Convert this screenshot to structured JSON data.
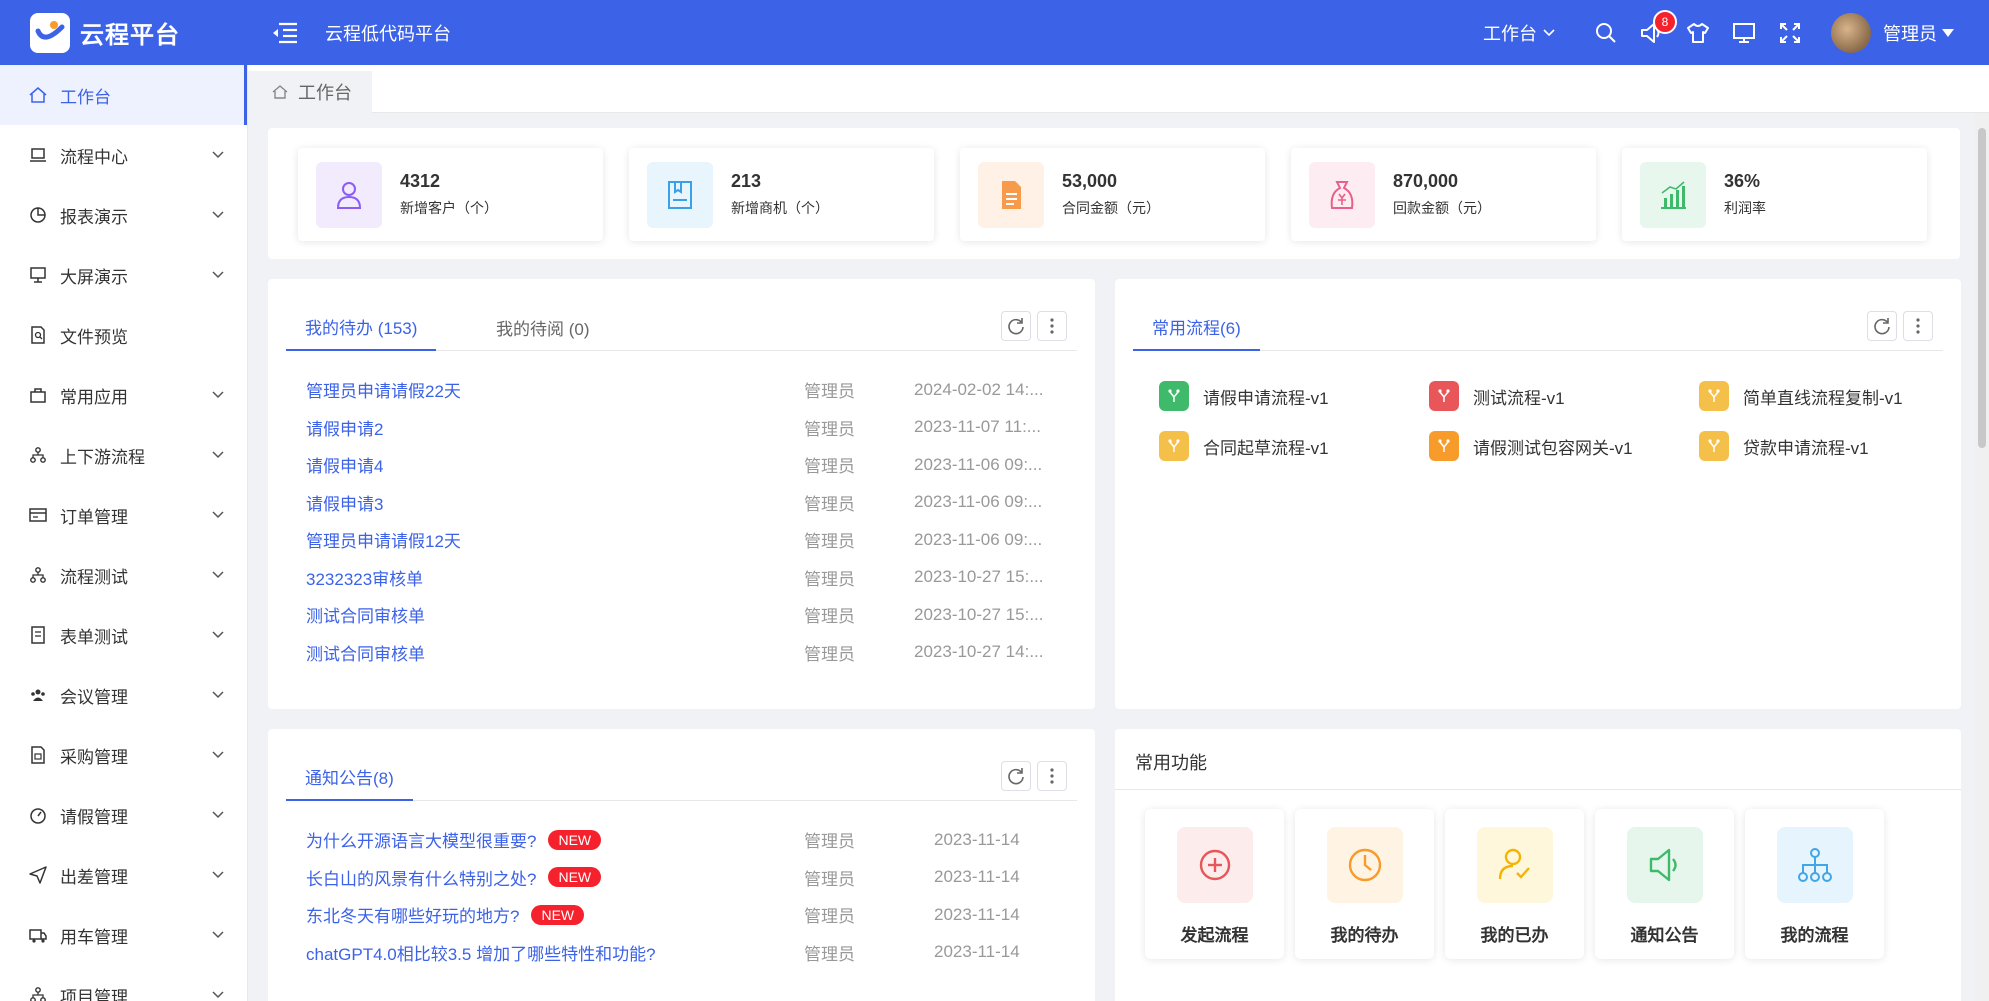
{
  "app": {
    "name": "云程平台",
    "title": "云程低代码平台"
  },
  "header": {
    "workspace_label": "工作台",
    "notification_count": "8",
    "user_name": "管理员"
  },
  "sidebar": {
    "items": [
      {
        "label": "工作台",
        "icon": "home-icon"
      },
      {
        "label": "流程中心",
        "icon": "laptop-icon"
      },
      {
        "label": "报表演示",
        "icon": "pie-chart-icon"
      },
      {
        "label": "大屏演示",
        "icon": "monitor-icon"
      },
      {
        "label": "文件预览",
        "icon": "file-search-icon"
      },
      {
        "label": "常用应用",
        "icon": "bag-icon"
      },
      {
        "label": "上下游流程",
        "icon": "cluster-icon"
      },
      {
        "label": "订单管理",
        "icon": "card-icon"
      },
      {
        "label": "流程测试",
        "icon": "cluster-icon"
      },
      {
        "label": "表单测试",
        "icon": "form-icon"
      },
      {
        "label": "会议管理",
        "icon": "team-icon"
      },
      {
        "label": "采购管理",
        "icon": "file-icon"
      },
      {
        "label": "请假管理",
        "icon": "dashboard-icon"
      },
      {
        "label": "出差管理",
        "icon": "send-icon"
      },
      {
        "label": "用车管理",
        "icon": "car-icon"
      },
      {
        "label": "项目管理",
        "icon": "cluster-icon"
      }
    ]
  },
  "breadcrumb_tab": "工作台",
  "stats": [
    {
      "value": "4312",
      "label": "新增客户（个）",
      "color": "#8b5cf6",
      "bg": "#f1ebfd",
      "icon": "user-icon"
    },
    {
      "value": "213",
      "label": "新增商机（个）",
      "color": "#3aa0e8",
      "bg": "#e9f5fd",
      "icon": "book-icon"
    },
    {
      "value": "53,000",
      "label": "合同金额（元）",
      "color": "#f79b4b",
      "bg": "#fff1e6",
      "icon": "contract-icon"
    },
    {
      "value": "870,000",
      "label": "回款金额（元）",
      "color": "#e8608a",
      "bg": "#fdedf2",
      "icon": "money-bag-icon"
    },
    {
      "value": "36%",
      "label": "利润率",
      "color": "#3fba6b",
      "bg": "#e8f7ee",
      "icon": "bar-chart-icon"
    }
  ],
  "todo": {
    "tabs": [
      "我的待办 (153)",
      "我的待阅 (0)"
    ],
    "rows": [
      {
        "title": "管理员申请请假22天",
        "user": "管理员",
        "time": "2024-02-02 14:..."
      },
      {
        "title": "请假申请2",
        "user": "管理员",
        "time": "2023-11-07 11:..."
      },
      {
        "title": "请假申请4",
        "user": "管理员",
        "time": "2023-11-06 09:..."
      },
      {
        "title": "请假申请3",
        "user": "管理员",
        "time": "2023-11-06 09:..."
      },
      {
        "title": "管理员申请请假12天",
        "user": "管理员",
        "time": "2023-11-06 09:..."
      },
      {
        "title": "3232323审核单",
        "user": "管理员",
        "time": "2023-10-27 15:..."
      },
      {
        "title": "测试合同审核单",
        "user": "管理员",
        "time": "2023-10-27 15:..."
      },
      {
        "title": "测试合同审核单",
        "user": "管理员",
        "time": "2023-10-27 14:..."
      }
    ]
  },
  "flows": {
    "tab": "常用流程(6)",
    "items": [
      {
        "label": "请假申请流程-v1",
        "color": "#3fba6b"
      },
      {
        "label": "测试流程-v1",
        "color": "#e8565a"
      },
      {
        "label": "简单直线流程复制-v1",
        "color": "#f4c04a"
      },
      {
        "label": "合同起草流程-v1",
        "color": "#f4c04a"
      },
      {
        "label": "请假测试包容网关-v1",
        "color": "#f79b2b"
      },
      {
        "label": "贷款申请流程-v1",
        "color": "#f4c04a"
      }
    ]
  },
  "notices": {
    "tab": "通知公告(8)",
    "new_label": "NEW",
    "rows": [
      {
        "title": "为什么开源语言大模型很重要?",
        "user": "管理员",
        "time": "2023-11-14",
        "is_new": true
      },
      {
        "title": "长白山的风景有什么特别之处?",
        "user": "管理员",
        "time": "2023-11-14",
        "is_new": true
      },
      {
        "title": "东北冬天有哪些好玩的地方?",
        "user": "管理员",
        "time": "2023-11-14",
        "is_new": true
      },
      {
        "title": "chatGPT4.0相比较3.5 增加了哪些特性和功能?",
        "user": "管理员",
        "time": "2023-11-14",
        "is_new": false
      }
    ]
  },
  "functions": {
    "title": "常用功能",
    "items": [
      {
        "label": "发起流程",
        "color": "#e8565a",
        "bg": "#fdecec",
        "icon": "plus-circle-icon"
      },
      {
        "label": "我的待办",
        "color": "#f79b2b",
        "bg": "#fff3e3",
        "icon": "clock-icon"
      },
      {
        "label": "我的已办",
        "color": "#f4b400",
        "bg": "#fff7dc",
        "icon": "user-check-icon"
      },
      {
        "label": "通知公告",
        "color": "#3fba6b",
        "bg": "#e6f6ec",
        "icon": "sound-icon"
      },
      {
        "label": "我的流程",
        "color": "#42a5e6",
        "bg": "#e6f4fd",
        "icon": "org-chart-icon"
      }
    ]
  }
}
